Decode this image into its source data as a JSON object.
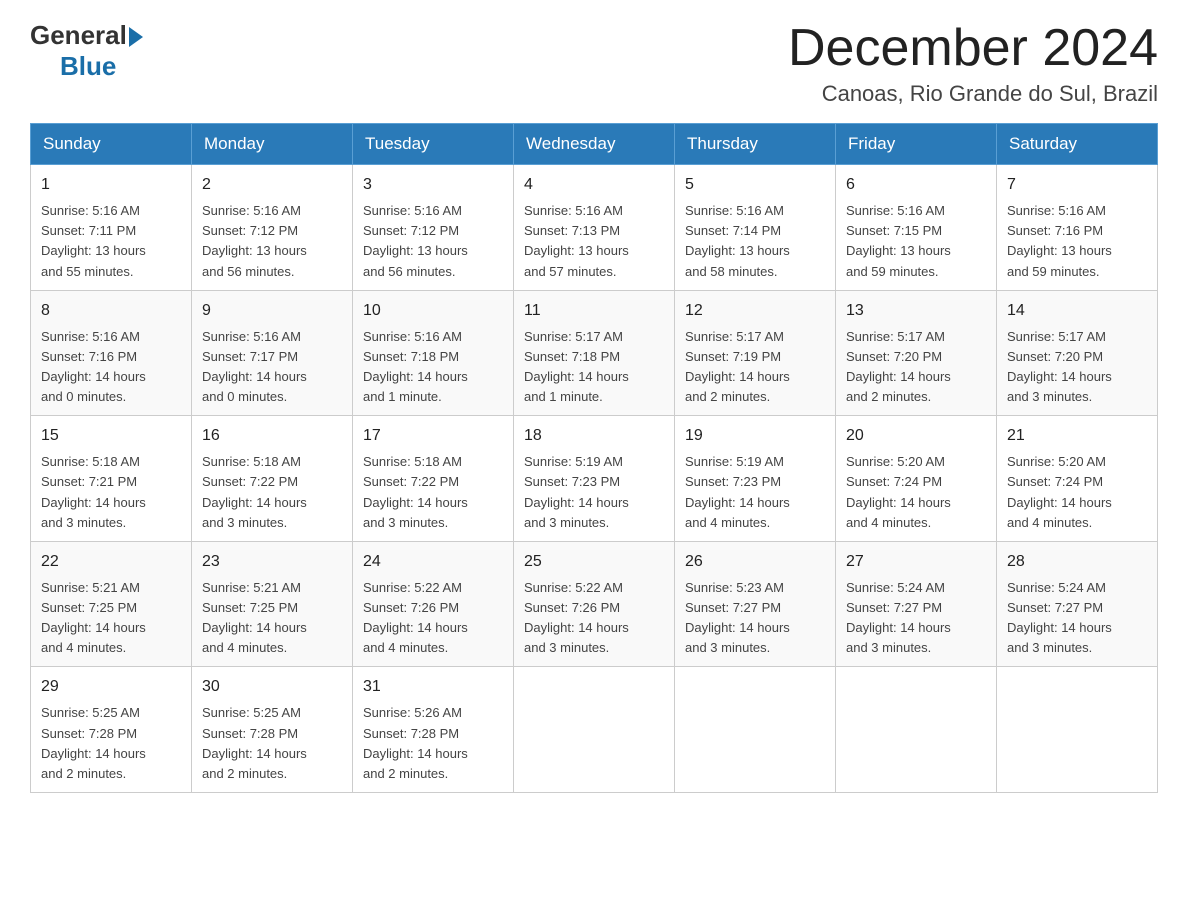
{
  "header": {
    "logo_general": "General",
    "logo_blue": "Blue",
    "title": "December 2024",
    "subtitle": "Canoas, Rio Grande do Sul, Brazil"
  },
  "days_of_week": [
    "Sunday",
    "Monday",
    "Tuesday",
    "Wednesday",
    "Thursday",
    "Friday",
    "Saturday"
  ],
  "weeks": [
    [
      {
        "day": "1",
        "sunrise": "5:16 AM",
        "sunset": "7:11 PM",
        "daylight": "13 hours and 55 minutes."
      },
      {
        "day": "2",
        "sunrise": "5:16 AM",
        "sunset": "7:12 PM",
        "daylight": "13 hours and 56 minutes."
      },
      {
        "day": "3",
        "sunrise": "5:16 AM",
        "sunset": "7:12 PM",
        "daylight": "13 hours and 56 minutes."
      },
      {
        "day": "4",
        "sunrise": "5:16 AM",
        "sunset": "7:13 PM",
        "daylight": "13 hours and 57 minutes."
      },
      {
        "day": "5",
        "sunrise": "5:16 AM",
        "sunset": "7:14 PM",
        "daylight": "13 hours and 58 minutes."
      },
      {
        "day": "6",
        "sunrise": "5:16 AM",
        "sunset": "7:15 PM",
        "daylight": "13 hours and 59 minutes."
      },
      {
        "day": "7",
        "sunrise": "5:16 AM",
        "sunset": "7:16 PM",
        "daylight": "13 hours and 59 minutes."
      }
    ],
    [
      {
        "day": "8",
        "sunrise": "5:16 AM",
        "sunset": "7:16 PM",
        "daylight": "14 hours and 0 minutes."
      },
      {
        "day": "9",
        "sunrise": "5:16 AM",
        "sunset": "7:17 PM",
        "daylight": "14 hours and 0 minutes."
      },
      {
        "day": "10",
        "sunrise": "5:16 AM",
        "sunset": "7:18 PM",
        "daylight": "14 hours and 1 minute."
      },
      {
        "day": "11",
        "sunrise": "5:17 AM",
        "sunset": "7:18 PM",
        "daylight": "14 hours and 1 minute."
      },
      {
        "day": "12",
        "sunrise": "5:17 AM",
        "sunset": "7:19 PM",
        "daylight": "14 hours and 2 minutes."
      },
      {
        "day": "13",
        "sunrise": "5:17 AM",
        "sunset": "7:20 PM",
        "daylight": "14 hours and 2 minutes."
      },
      {
        "day": "14",
        "sunrise": "5:17 AM",
        "sunset": "7:20 PM",
        "daylight": "14 hours and 3 minutes."
      }
    ],
    [
      {
        "day": "15",
        "sunrise": "5:18 AM",
        "sunset": "7:21 PM",
        "daylight": "14 hours and 3 minutes."
      },
      {
        "day": "16",
        "sunrise": "5:18 AM",
        "sunset": "7:22 PM",
        "daylight": "14 hours and 3 minutes."
      },
      {
        "day": "17",
        "sunrise": "5:18 AM",
        "sunset": "7:22 PM",
        "daylight": "14 hours and 3 minutes."
      },
      {
        "day": "18",
        "sunrise": "5:19 AM",
        "sunset": "7:23 PM",
        "daylight": "14 hours and 3 minutes."
      },
      {
        "day": "19",
        "sunrise": "5:19 AM",
        "sunset": "7:23 PM",
        "daylight": "14 hours and 4 minutes."
      },
      {
        "day": "20",
        "sunrise": "5:20 AM",
        "sunset": "7:24 PM",
        "daylight": "14 hours and 4 minutes."
      },
      {
        "day": "21",
        "sunrise": "5:20 AM",
        "sunset": "7:24 PM",
        "daylight": "14 hours and 4 minutes."
      }
    ],
    [
      {
        "day": "22",
        "sunrise": "5:21 AM",
        "sunset": "7:25 PM",
        "daylight": "14 hours and 4 minutes."
      },
      {
        "day": "23",
        "sunrise": "5:21 AM",
        "sunset": "7:25 PM",
        "daylight": "14 hours and 4 minutes."
      },
      {
        "day": "24",
        "sunrise": "5:22 AM",
        "sunset": "7:26 PM",
        "daylight": "14 hours and 4 minutes."
      },
      {
        "day": "25",
        "sunrise": "5:22 AM",
        "sunset": "7:26 PM",
        "daylight": "14 hours and 3 minutes."
      },
      {
        "day": "26",
        "sunrise": "5:23 AM",
        "sunset": "7:27 PM",
        "daylight": "14 hours and 3 minutes."
      },
      {
        "day": "27",
        "sunrise": "5:24 AM",
        "sunset": "7:27 PM",
        "daylight": "14 hours and 3 minutes."
      },
      {
        "day": "28",
        "sunrise": "5:24 AM",
        "sunset": "7:27 PM",
        "daylight": "14 hours and 3 minutes."
      }
    ],
    [
      {
        "day": "29",
        "sunrise": "5:25 AM",
        "sunset": "7:28 PM",
        "daylight": "14 hours and 2 minutes."
      },
      {
        "day": "30",
        "sunrise": "5:25 AM",
        "sunset": "7:28 PM",
        "daylight": "14 hours and 2 minutes."
      },
      {
        "day": "31",
        "sunrise": "5:26 AM",
        "sunset": "7:28 PM",
        "daylight": "14 hours and 2 minutes."
      },
      null,
      null,
      null,
      null
    ]
  ],
  "labels": {
    "sunrise": "Sunrise:",
    "sunset": "Sunset:",
    "daylight": "Daylight:"
  }
}
